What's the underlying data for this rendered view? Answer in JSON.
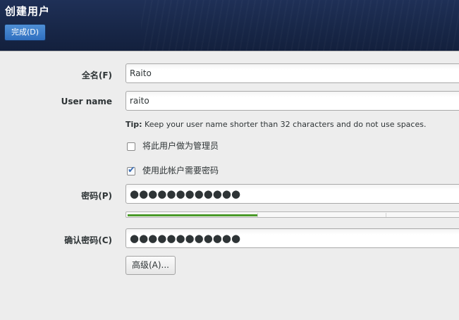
{
  "header": {
    "title": "创建用户",
    "done_label": "完成(D)"
  },
  "form": {
    "fullname_label": "全名(F)",
    "fullname_value": "Raito",
    "username_label": "User name",
    "username_value": "raito",
    "tip_prefix": "Tip:",
    "tip_text": " Keep your user name shorter than 32 characters and do not use spaces.",
    "admin_checkbox_label": "将此用户做为管理员",
    "admin_checked": false,
    "require_password_label": "使用此帐户需要密码",
    "require_password_checked": true,
    "password_label": "密码(P)",
    "password_value": "●●●●●●●●●●●●",
    "password_strength": 0.39,
    "confirm_label": "确认密码(C)",
    "confirm_value": "●●●●●●●●●●●●",
    "advanced_label": "高级(A)..."
  },
  "colors": {
    "header_bg": "#182748",
    "accent": "#3c6eb4",
    "strength_fill": "#4a9a2a"
  }
}
